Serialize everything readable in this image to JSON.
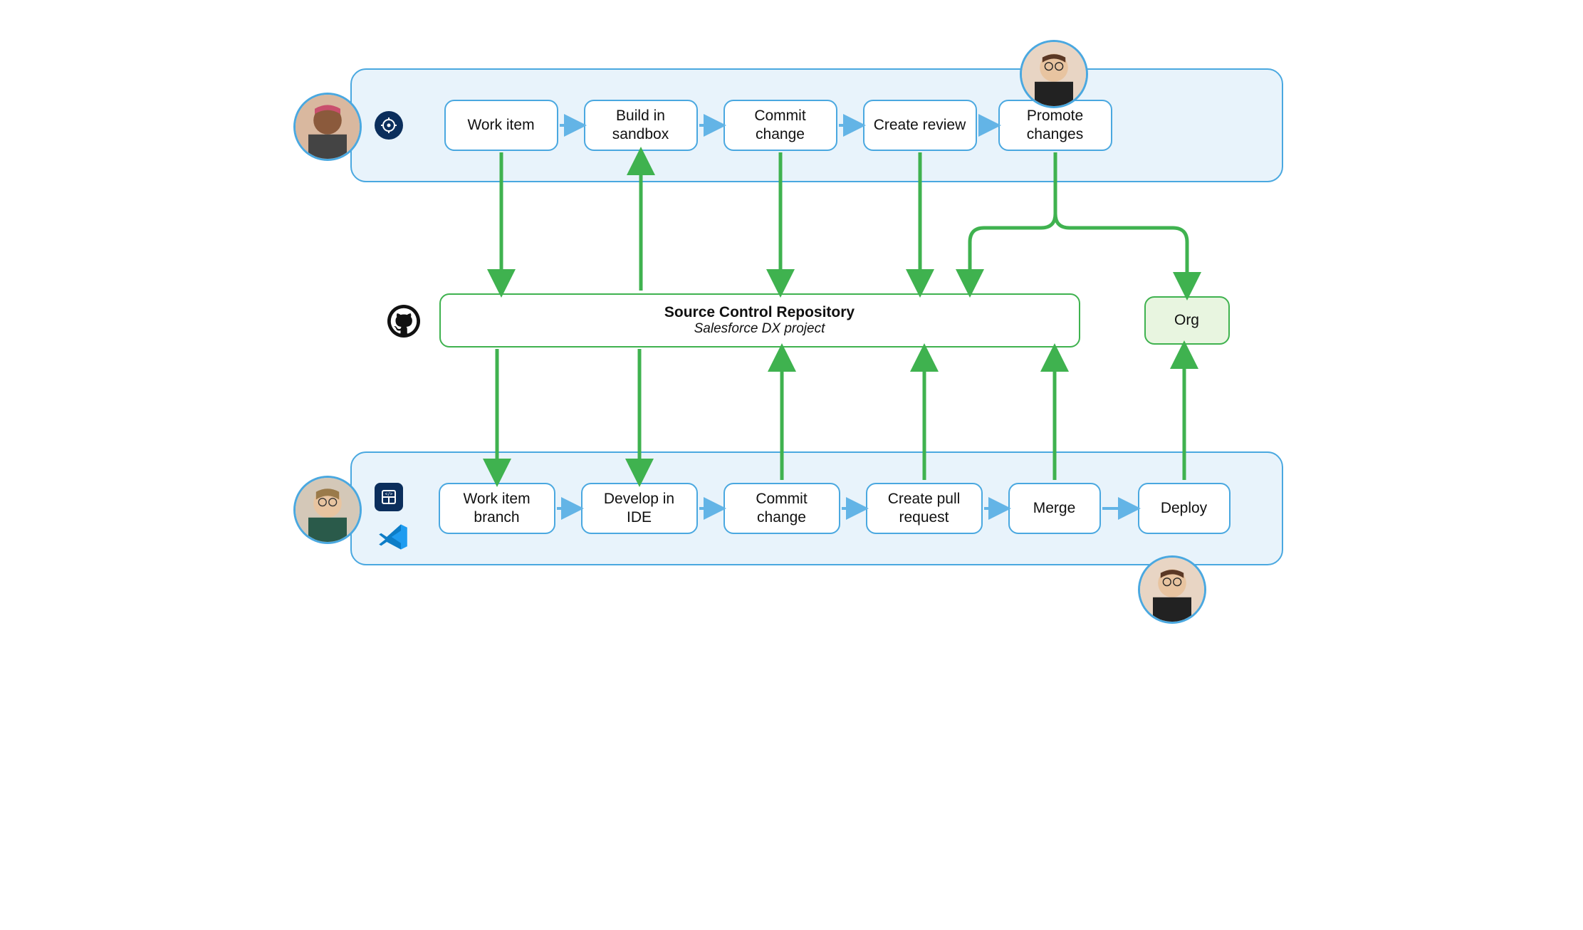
{
  "top_lane": {
    "nodes": [
      {
        "label": "Work item"
      },
      {
        "label": "Build in sandbox"
      },
      {
        "label": "Commit change"
      },
      {
        "label": "Create review"
      },
      {
        "label": "Promote changes"
      }
    ]
  },
  "bottom_lane": {
    "nodes": [
      {
        "label": "Work item branch"
      },
      {
        "label": "Develop in IDE"
      },
      {
        "label": "Commit change"
      },
      {
        "label": "Create pull request"
      },
      {
        "label": "Merge"
      },
      {
        "label": "Deploy"
      }
    ]
  },
  "repo": {
    "title": "Source Control Repository",
    "subtitle": "Salesforce DX project"
  },
  "org": {
    "label": "Org"
  },
  "icons": {
    "target": "target-icon",
    "code_builder": "code-builder-icon",
    "vscode": "vscode-icon",
    "github": "github-icon"
  },
  "avatars": {
    "admin": "avatar-admin",
    "developer": "avatar-developer",
    "release_manager_top": "avatar-release-manager",
    "release_manager_bottom": "avatar-release-manager"
  },
  "colors": {
    "lane_fill": "#e8f3fb",
    "lane_border": "#4aa8e0",
    "node_border": "#4aa8e0",
    "green_border": "#3fb24f",
    "org_fill": "#e8f5e0",
    "arrow_blue": "#63b4e6",
    "arrow_green": "#3fb24f",
    "badge_navy": "#0b2e5c",
    "vscode_blue": "#1f9cf0"
  }
}
